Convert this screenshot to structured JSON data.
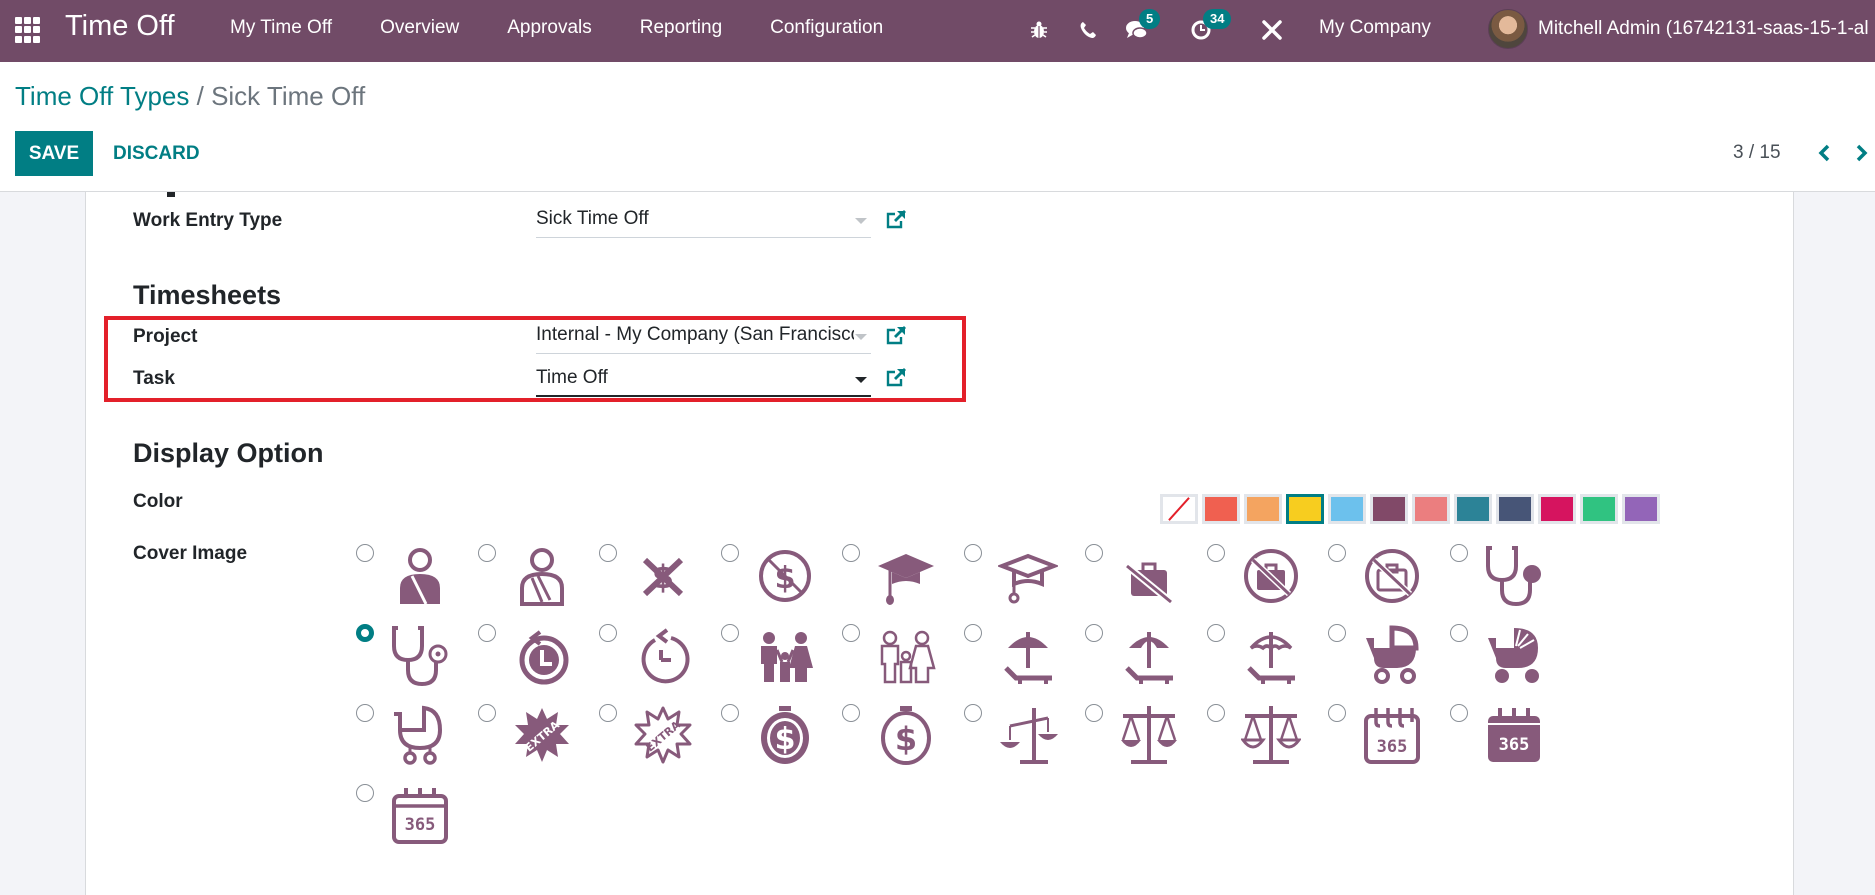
{
  "navbar": {
    "app_name": "Time Off",
    "menu": [
      "My Time Off",
      "Overview",
      "Approvals",
      "Reporting",
      "Configuration"
    ],
    "systray": {
      "bug_icon": "bug-icon",
      "phone_icon": "phone-icon",
      "messages_icon": "chat-icon",
      "messages_count": "5",
      "activities_icon": "clock-icon",
      "activities_count": "34",
      "settings_icon": "tools-icon"
    },
    "company": "My Company",
    "user": "Mitchell Admin (16742131-saas-15-1-al"
  },
  "control_panel": {
    "breadcrumb_parent": "Time Off Types",
    "breadcrumb_separator": "/",
    "breadcrumb_current": "Sick Time Off",
    "save_label": "SAVE",
    "discard_label": "DISCARD",
    "pager": "3 / 15"
  },
  "form": {
    "work_entry_type": {
      "label": "Work Entry Type",
      "value": "Sick Time Off"
    },
    "timesheets": {
      "title": "Timesheets",
      "project": {
        "label": "Project",
        "value": "Internal - My Company (San Francisco)"
      },
      "task": {
        "label": "Task",
        "value": "Time Off"
      }
    },
    "display_option": {
      "title": "Display Option",
      "color_label": "Color",
      "colors": [
        {
          "name": "no-color",
          "hex": "#ffffff"
        },
        {
          "name": "red",
          "hex": "#f06050"
        },
        {
          "name": "orange",
          "hex": "#f4a460"
        },
        {
          "name": "yellow",
          "hex": "#f7cd1f",
          "selected": true
        },
        {
          "name": "light-blue",
          "hex": "#6cc1ed"
        },
        {
          "name": "dark-purple",
          "hex": "#814968"
        },
        {
          "name": "salmon-pink",
          "hex": "#eb7e7f"
        },
        {
          "name": "medium-blue",
          "hex": "#2c8397"
        },
        {
          "name": "dark-blue",
          "hex": "#475577"
        },
        {
          "name": "fuchsia",
          "hex": "#d6145f"
        },
        {
          "name": "green",
          "hex": "#30c381"
        },
        {
          "name": "purple",
          "hex": "#9365b8"
        }
      ],
      "cover_image_label": "Cover Image",
      "cover_images": [
        {
          "icon": "injured-person-filled-icon",
          "selected": false
        },
        {
          "icon": "injured-person-outline-icon",
          "selected": false
        },
        {
          "icon": "no-money-icon",
          "selected": false
        },
        {
          "icon": "no-money-circle-icon",
          "selected": false
        },
        {
          "icon": "graduation-cap-filled-icon",
          "selected": false
        },
        {
          "icon": "graduation-cap-outline-icon",
          "selected": false
        },
        {
          "icon": "no-briefcase-icon",
          "selected": false
        },
        {
          "icon": "no-briefcase-circle-filled-icon",
          "selected": false
        },
        {
          "icon": "no-briefcase-circle-outline-icon",
          "selected": false
        },
        {
          "icon": "stethoscope-filled-icon",
          "selected": false
        },
        {
          "icon": "stethoscope-outline-icon",
          "selected": true
        },
        {
          "icon": "clock-back-filled-icon",
          "selected": false
        },
        {
          "icon": "clock-back-outline-icon",
          "selected": false
        },
        {
          "icon": "family-filled-icon",
          "selected": false
        },
        {
          "icon": "family-outline-icon",
          "selected": false
        },
        {
          "icon": "beach-chair-filled-icon",
          "selected": false
        },
        {
          "icon": "beach-chair-umbrella-icon",
          "selected": false
        },
        {
          "icon": "beach-chair-outline-icon",
          "selected": false
        },
        {
          "icon": "stroller-filled-icon",
          "selected": false
        },
        {
          "icon": "stroller-hood-icon",
          "selected": false
        },
        {
          "icon": "stroller-outline-icon",
          "selected": false
        },
        {
          "icon": "extra-badge-filled-icon",
          "selected": false
        },
        {
          "icon": "extra-badge-outline-icon",
          "selected": false
        },
        {
          "icon": "money-stopwatch-filled-icon",
          "selected": false
        },
        {
          "icon": "money-stopwatch-outline-icon",
          "selected": false
        },
        {
          "icon": "scale-unbalanced-icon",
          "selected": false
        },
        {
          "icon": "scale-filled-icon",
          "selected": false
        },
        {
          "icon": "scale-outline-icon",
          "selected": false
        },
        {
          "icon": "calendar-365-outline-icon",
          "selected": false
        },
        {
          "icon": "calendar-365-filled-icon",
          "selected": false
        },
        {
          "icon": "calendar-365-simple-icon",
          "selected": false
        }
      ],
      "icon_color": "#875a7b"
    }
  },
  "colors": {
    "navbar": "#714b67",
    "accent": "#017e84",
    "highlight": "#e3202a"
  }
}
